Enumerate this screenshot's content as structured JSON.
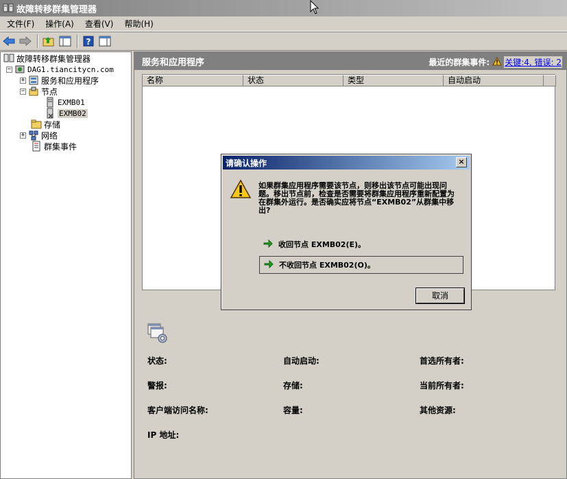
{
  "window": {
    "title": "故障转移群集管理器"
  },
  "menu": [
    "文件(F)",
    "操作(A)",
    "查看(V)",
    "帮助(H)"
  ],
  "tree": {
    "root": "故障转移群集管理器",
    "cluster": "DAG1.tiancitycn.com",
    "services": "服务和应用程序",
    "nodes": "节点",
    "node1": "EXMB01",
    "node2": "EXMB02",
    "storage": "存储",
    "network": "网络",
    "events": "群集事件"
  },
  "pane": {
    "title": "服务和应用程序",
    "recent_label": "最近的群集事件:",
    "recent_link": "关键:4, 错误: 2",
    "columns": [
      "名称",
      "状态",
      "类型",
      "自动启动"
    ]
  },
  "details": {
    "status": "状态:",
    "autostart": "自动启动:",
    "preferred_owner": "首选所有者:",
    "alert": "警报:",
    "storage": "存储:",
    "current_owner": "当前所有者:",
    "client_access": "客户端访问名称:",
    "capacity": "容量:",
    "other_resources": "其他资源:",
    "ip": "IP 地址:"
  },
  "dialog": {
    "title": "请确认操作",
    "message": "如果群集应用程序需要该节点，则移出该节点可能出现问题。移出节点前，检查是否需要将群集应用程序重新配置为在群集外运行。是否确实应将节点“EXMB02”从群集中移出?",
    "option_yes": "收回节点 EXMB02(E)。",
    "option_no": "不收回节点 EXMB02(O)。",
    "cancel": "取消",
    "close": "×"
  }
}
